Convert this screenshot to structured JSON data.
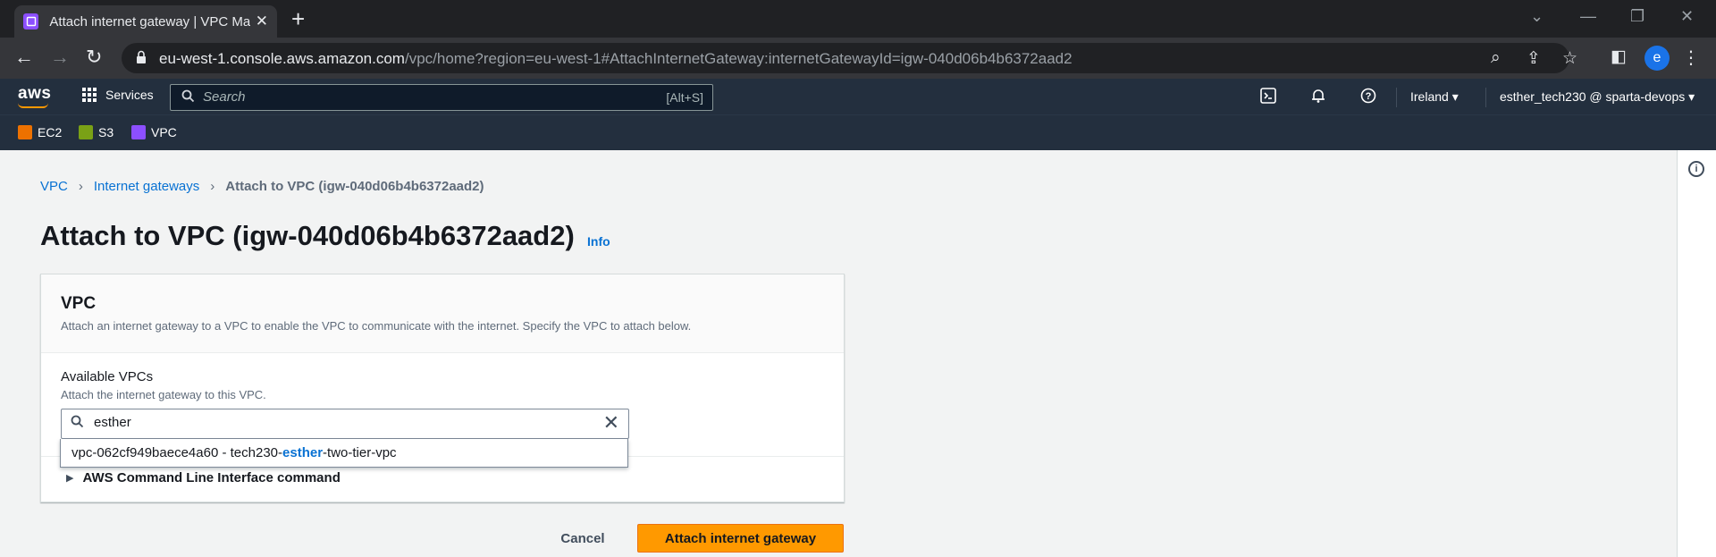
{
  "browser": {
    "tab_title": "Attach internet gateway | VPC Ma",
    "url_host": "eu-west-1.console.aws.amazon.com",
    "url_path": "/vpc/home?region=eu-west-1#AttachInternetGateway:internetGatewayId=igw-040d06b4b6372aad2",
    "profile_initial": "e"
  },
  "aws_header": {
    "logo": "aws",
    "services_label": "Services",
    "search_placeholder": "Search",
    "search_shortcut": "[Alt+S]",
    "region": "Ireland ▾",
    "account": "esther_tech230 @ sparta-devops ▾"
  },
  "favorites": [
    {
      "label": "EC2",
      "color": "#ed7100"
    },
    {
      "label": "S3",
      "color": "#7aa116"
    },
    {
      "label": "VPC",
      "color": "#8c4fff"
    }
  ],
  "breadcrumb": {
    "vpc": "VPC",
    "internet_gateways": "Internet gateways",
    "current": "Attach to VPC (igw-040d06b4b6372aad2)"
  },
  "page": {
    "title": "Attach to VPC (igw-040d06b4b6372aad2)",
    "info_link": "Info"
  },
  "vpc_section": {
    "title": "VPC",
    "description": "Attach an internet gateway to a VPC to enable the VPC to communicate with the internet. Specify the VPC to attach below.",
    "field_label": "Available VPCs",
    "field_description": "Attach the internet gateway to this VPC.",
    "search_value": "esther",
    "option": {
      "prefix": "vpc-062cf949baece4a60 - tech230-",
      "match": "esther",
      "suffix": "-two-tier-vpc"
    },
    "cli_label": "AWS Command Line Interface command"
  },
  "actions": {
    "cancel": "Cancel",
    "primary": "Attach internet gateway"
  }
}
